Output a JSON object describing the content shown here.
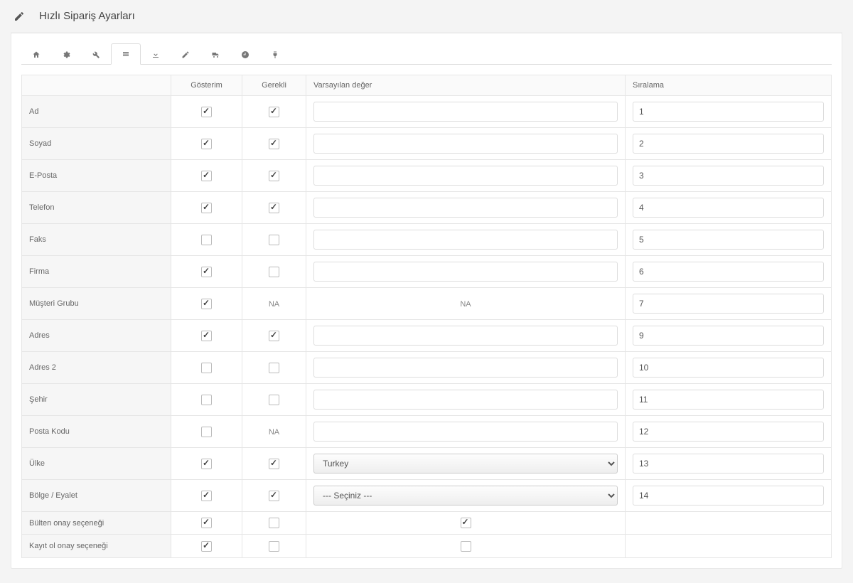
{
  "page": {
    "title": "Hızlı Sipariş Ayarları"
  },
  "headers": {
    "label": "",
    "show": "Gösterim",
    "required": "Gerekli",
    "default": "Varsayılan değer",
    "sort": "Sıralama"
  },
  "na_text": "NA",
  "country_options": {
    "selected": "Turkey"
  },
  "region_options": {
    "selected": "--- Seçiniz ---"
  },
  "rows": [
    {
      "key": "ad",
      "label": "Ad",
      "show": true,
      "required": true,
      "default_type": "text",
      "default": "",
      "sort": "1"
    },
    {
      "key": "soyad",
      "label": "Soyad",
      "show": true,
      "required": true,
      "default_type": "text",
      "default": "",
      "sort": "2"
    },
    {
      "key": "eposta",
      "label": "E-Posta",
      "show": true,
      "required": true,
      "default_type": "text",
      "default": "",
      "sort": "3"
    },
    {
      "key": "telefon",
      "label": "Telefon",
      "show": true,
      "required": true,
      "default_type": "text",
      "default": "",
      "sort": "4"
    },
    {
      "key": "faks",
      "label": "Faks",
      "show": false,
      "required": false,
      "default_type": "text",
      "default": "",
      "sort": "5"
    },
    {
      "key": "firma",
      "label": "Firma",
      "show": true,
      "required": false,
      "default_type": "text",
      "default": "",
      "sort": "6"
    },
    {
      "key": "mgrubu",
      "label": "Müşteri Grubu",
      "show": true,
      "required": "na",
      "default_type": "na",
      "default": "",
      "sort": "7"
    },
    {
      "key": "adres",
      "label": "Adres",
      "show": true,
      "required": true,
      "default_type": "text",
      "default": "",
      "sort": "9"
    },
    {
      "key": "adres2",
      "label": "Adres 2",
      "show": false,
      "required": false,
      "default_type": "text",
      "default": "",
      "sort": "10"
    },
    {
      "key": "sehir",
      "label": "Şehir",
      "show": false,
      "required": false,
      "default_type": "text",
      "default": "",
      "sort": "11"
    },
    {
      "key": "postakodu",
      "label": "Posta Kodu",
      "show": false,
      "required": "na",
      "default_type": "text",
      "default": "",
      "sort": "12"
    },
    {
      "key": "ulke",
      "label": "Ülke",
      "show": true,
      "required": true,
      "default_type": "select",
      "default": "Turkey",
      "sort": "13"
    },
    {
      "key": "bolge",
      "label": "Bölge / Eyalet",
      "show": true,
      "required": true,
      "default_type": "select",
      "default": "--- Seçiniz ---",
      "sort": "14"
    },
    {
      "key": "bulten",
      "label": "Bülten onay seçeneği",
      "show": true,
      "required": false,
      "default_type": "check",
      "default": true,
      "sort": ""
    },
    {
      "key": "kayit",
      "label": "Kayıt ol onay seçeneği",
      "show": true,
      "required": false,
      "default_type": "check",
      "default": false,
      "sort": ""
    }
  ]
}
